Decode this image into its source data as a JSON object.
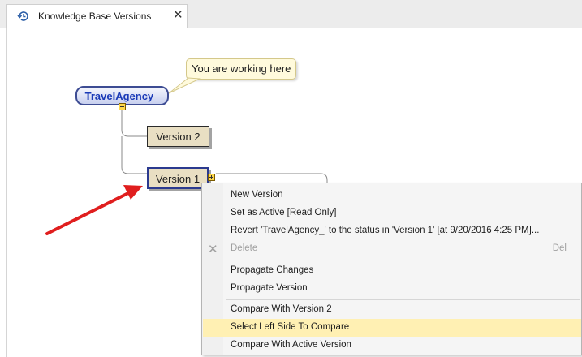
{
  "tab": {
    "title": "Knowledge Base Versions",
    "close_glyph": "✕",
    "icon": "history-icon"
  },
  "canvas": {
    "tooltip": "You are working here",
    "root_node": "TravelAgency_",
    "versions": [
      "Version 2",
      "Version 1"
    ]
  },
  "context_menu": {
    "items": [
      {
        "label": "New Version"
      },
      {
        "label": "Set as Active [Read Only]"
      },
      {
        "label": "Revert 'TravelAgency_' to the status in 'Version 1' [at 9/20/2016 4:25 PM]..."
      },
      {
        "label": "Delete",
        "shortcut": "Del",
        "icon_glyph": "✕",
        "icon": "delete-x-icon",
        "disabled": true
      },
      {
        "label": "Propagate Changes"
      },
      {
        "label": "Propagate Version"
      },
      {
        "label": "Compare With Version 2"
      },
      {
        "label": "Select Left Side To Compare",
        "highlighted": true
      },
      {
        "label": "Compare With Active Version"
      }
    ]
  },
  "colors": {
    "menu_highlight": "#fff0b3",
    "root_text": "#1a3ab7",
    "arrow": "#e01e1e",
    "version_fill": "#e9dfc3"
  }
}
